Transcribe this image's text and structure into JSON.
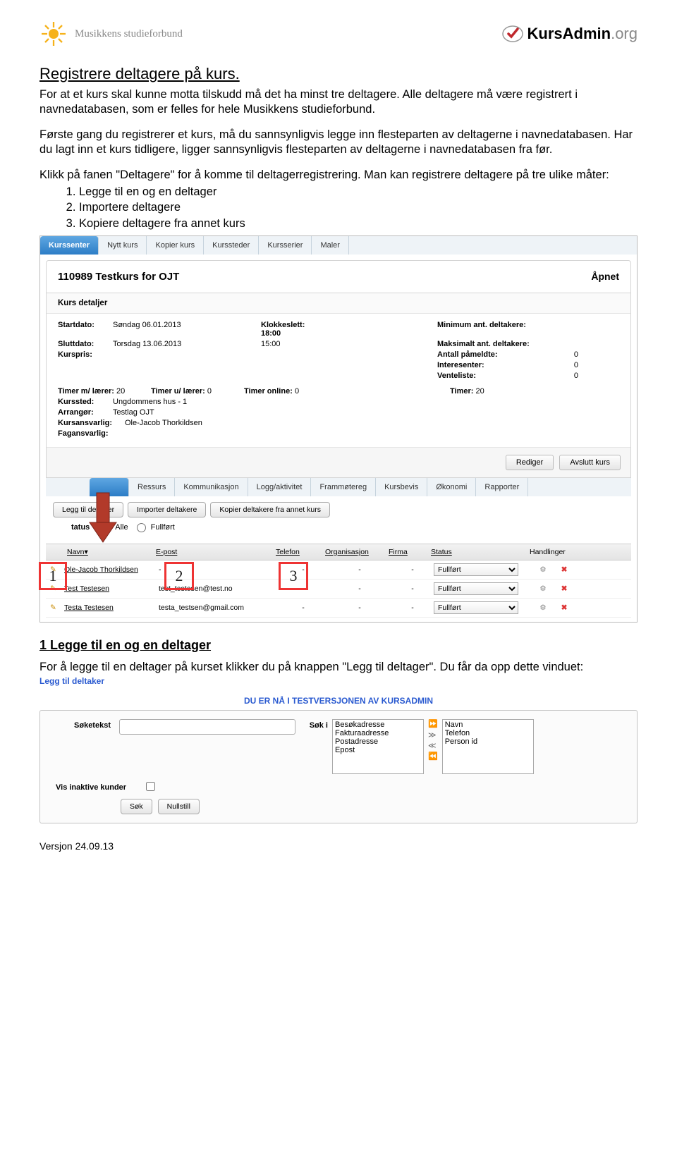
{
  "brand": {
    "left": "Musikkens studieforbund",
    "right_text": "KursAdmin",
    "right_suffix": ".org"
  },
  "title": "Registrere deltagere på kurs.",
  "para1": "For at et kurs skal kunne motta tilskudd må det ha minst tre deltagere. Alle deltagere må være registrert i navnedatabasen, som er felles for hele Musikkens studieforbund.",
  "para2": "Første gang du registrerer et kurs, må du sannsynligvis legge inn flesteparten av deltagerne i navnedatabasen. Har du lagt inn et kurs tidligere, ligger sannsynligvis flesteparten av deltagerne i navnedatabasen fra før.",
  "para3": "Klikk på fanen \"Deltagere\" for å komme til deltagerregistrering. Man kan registrere deltagere på tre ulike måter:",
  "list": [
    "Legge til en og en deltager",
    "Importere deltagere",
    "Kopiere deltagere fra annet kurs"
  ],
  "tabs_top": [
    "Kurssenter",
    "Nytt kurs",
    "Kopier kurs",
    "Kurssteder",
    "Kursserier",
    "Maler"
  ],
  "course_title": "110989 Testkurs for OJT",
  "course_status": "Åpnet",
  "section_label": "Kurs detaljer",
  "labels": {
    "start": "Startdato:",
    "slut": "Sluttdato:",
    "kurspris": "Kurspris:",
    "klokk": "Klokkeslett:",
    "klokk2": "",
    "min": "Minimum ant. deltakere:",
    "max": "Maksimalt ant. deltakere:",
    "pam": "Antall påmeldte:",
    "int": "Interesenter:",
    "vent": "Venteliste:",
    "timml": "Timer m/ lærer:",
    "timul": "Timer u/ lærer:",
    "timon": "Timer online:",
    "timer": "Timer:",
    "kurssted": "Kurssted:",
    "arranger": "Arrangør:",
    "kursansv": "Kursansvarlig:",
    "fagansv": "Fagansvarlig:"
  },
  "vals": {
    "start": "Søndag 06.01.2013",
    "slut": "Torsdag 13.06.2013",
    "kurspris": "",
    "kl1": "18:00",
    "kl2": "15:00",
    "pam": "0",
    "int": "0",
    "vent": "0",
    "timml": "20",
    "timul": "0",
    "timon": "0",
    "timer": "20",
    "kurssted": "Ungdommens hus - 1",
    "arranger": "Testlag OJT",
    "kursansv": "Ole-Jacob Thorkildsen",
    "fagansv": ""
  },
  "btns": {
    "rediger": "Rediger",
    "avslutt": "Avslutt kurs"
  },
  "tabs2": [
    "Ressurs",
    "Kommunikasjon",
    "Logg/aktivitet",
    "Frammøtereg",
    "Kursbevis",
    "Økonomi",
    "Rapporter"
  ],
  "actbtns": [
    "Legg til deltaker",
    "Importer deltakere",
    "Kopier deltakere fra annet kurs"
  ],
  "statuslabel": "tatus",
  "radio_alle": "Alle",
  "radio_full": "Fullført",
  "thead": {
    "navn": "Navn",
    "epost": "E-post",
    "tel": "Telefon",
    "org": "Organisasjon",
    "firma": "Firma",
    "status": "Status",
    "hand": "Handlinger"
  },
  "rows": [
    {
      "name": "Ole-Jacob Thorkildsen",
      "email": "-",
      "tel": "-",
      "org": "-",
      "firma": "-",
      "status": "Fullført"
    },
    {
      "name": "Test Testesen",
      "email": "test_testesen@test.no",
      "tel": "-",
      "org": "-",
      "firma": "-",
      "status": "Fullført"
    },
    {
      "name": "Testa Testesen",
      "email": "testa_testsen@gmail.com",
      "tel": "-",
      "org": "-",
      "firma": "-",
      "status": "Fullført"
    }
  ],
  "callouts": {
    "c1": "1",
    "c2": "2",
    "c3": "3"
  },
  "h2": "1 Legge til en og en deltager",
  "para4": "For å legge til en deltager på kurset klikker du på knappen \"Legg til deltager\". Du får da opp dette vinduet:",
  "s2": {
    "title": "Legg til deltaker",
    "banner": "DU ER NÅ I TESTVERSJONEN AV KURSADMIN",
    "lab_sok": "Søketekst",
    "lab_soki": "Søk i",
    "left": [
      "Besøkadresse",
      "Fakturaadresse",
      "Postadresse",
      "Epost"
    ],
    "right": [
      "Navn",
      "Telefon",
      "Person id"
    ],
    "inactive": "Vis inaktive kunder",
    "sok": "Søk",
    "null": "Nullstill"
  },
  "footer": "Versjon 24.09.13"
}
